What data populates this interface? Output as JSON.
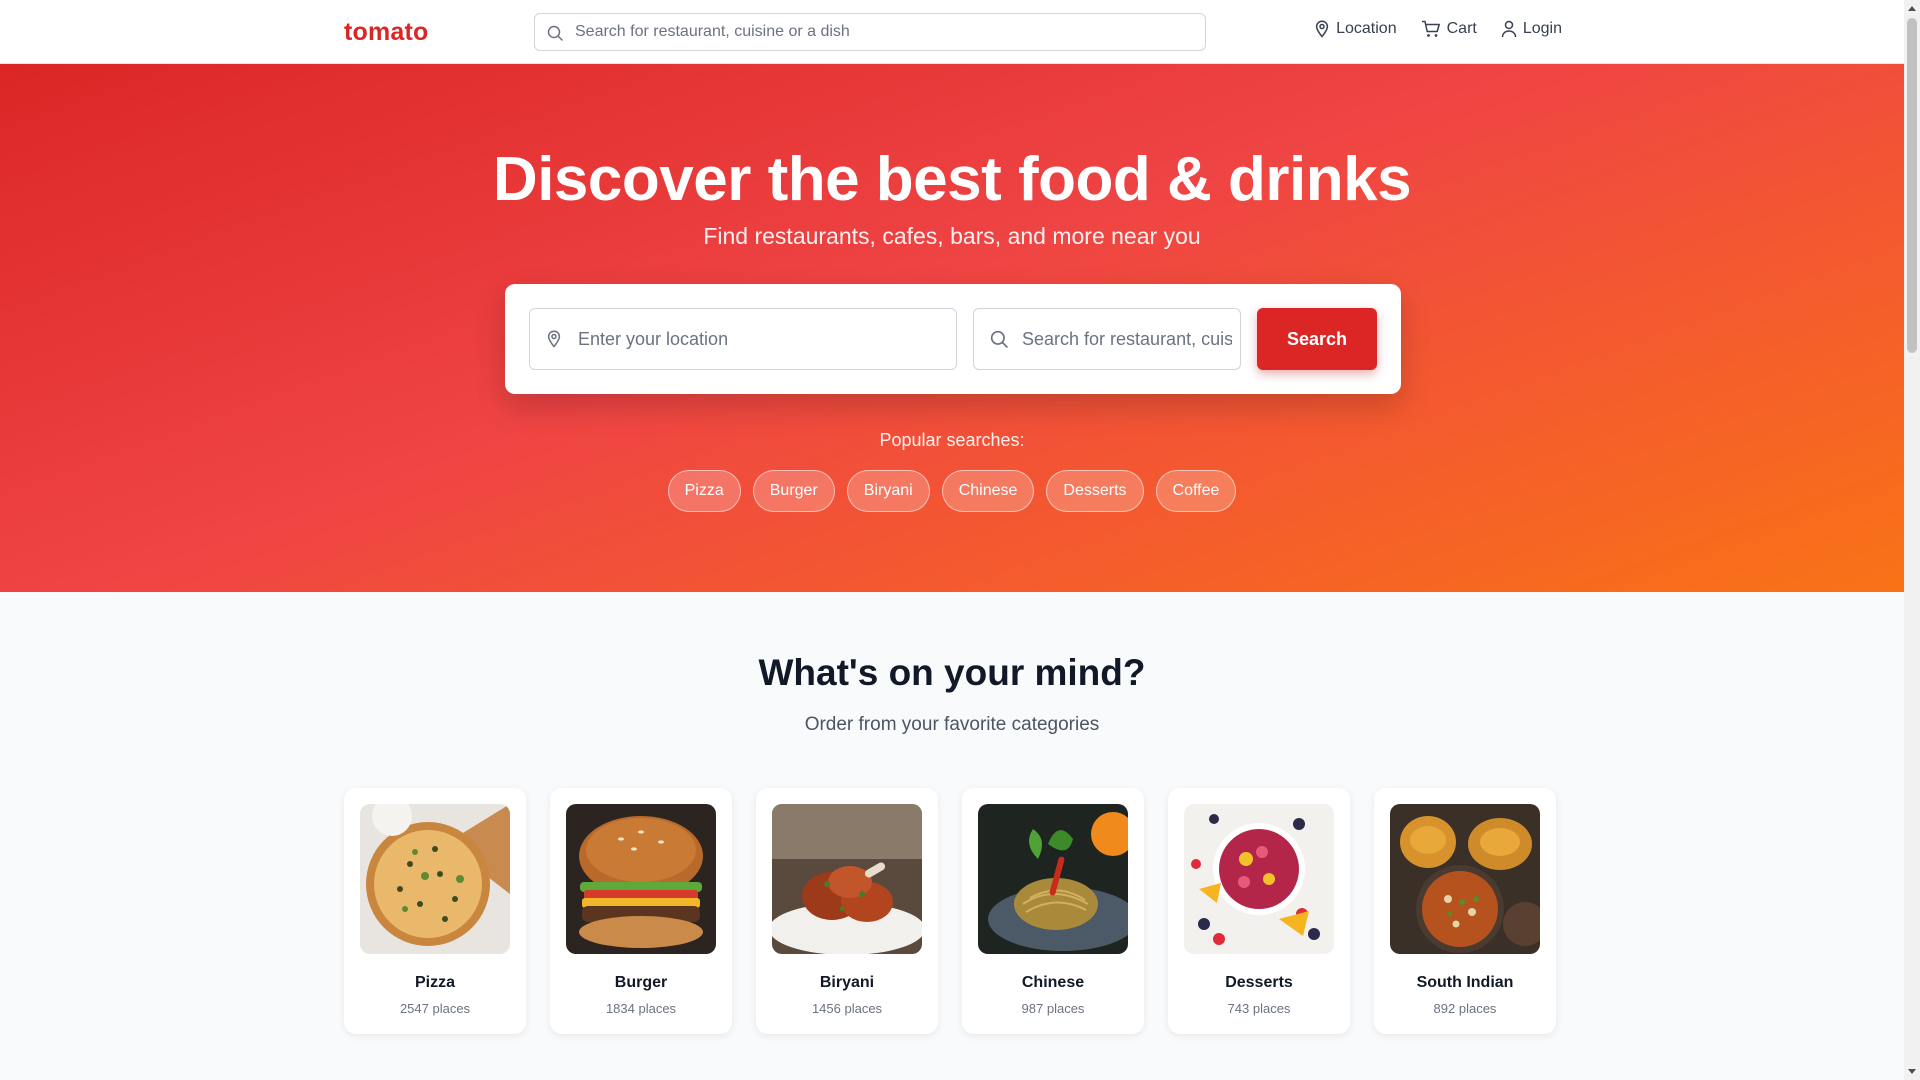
{
  "header": {
    "logo": "tomato",
    "search_placeholder": "Search for restaurant, cuisine or a dish",
    "nav": {
      "location": "Location",
      "cart": "Cart",
      "login": "Login"
    }
  },
  "hero": {
    "title": "Discover the best food & drinks",
    "subtitle": "Find restaurants, cafes, bars, and more near you",
    "location_placeholder": "Enter your location",
    "query_placeholder": "Search for restaurant, cuisine or a dish",
    "search_button": "Search",
    "popular_label": "Popular searches:",
    "popular": [
      "Pizza",
      "Burger",
      "Biryani",
      "Chinese",
      "Desserts",
      "Coffee"
    ]
  },
  "categories": {
    "title": "What's on your mind?",
    "subtitle": "Order from your favorite categories",
    "items": [
      {
        "name": "Pizza",
        "count": "2547 places"
      },
      {
        "name": "Burger",
        "count": "1834 places"
      },
      {
        "name": "Biryani",
        "count": "1456 places"
      },
      {
        "name": "Chinese",
        "count": "987 places"
      },
      {
        "name": "Desserts",
        "count": "743 places"
      },
      {
        "name": "South Indian",
        "count": "892 places"
      }
    ]
  },
  "colors": {
    "brand": "#dc2626",
    "hero_start": "#dc2626",
    "hero_end": "#f97316"
  }
}
